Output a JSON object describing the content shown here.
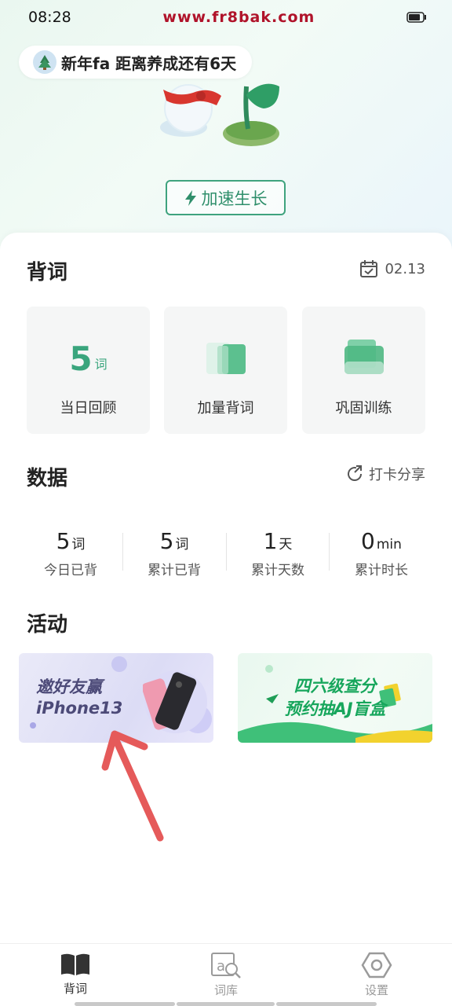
{
  "status_bar": {
    "time": "08:28",
    "watermark": "www.fr8bak.com"
  },
  "plant": {
    "message": "新年fa 距离养成还有6天",
    "accelerate_label": "加速生长"
  },
  "study": {
    "title": "背词",
    "date": "02.13",
    "tiles": [
      {
        "value": "5",
        "unit": "词",
        "label": "当日回顾"
      },
      {
        "label": "加量背词"
      },
      {
        "label": "巩固训练"
      }
    ]
  },
  "stats": {
    "title": "数据",
    "share_label": "打卡分享",
    "items": [
      {
        "value": "5",
        "unit": "词",
        "label": "今日已背"
      },
      {
        "value": "5",
        "unit": "词",
        "label": "累计已背"
      },
      {
        "value": "1",
        "unit": "天",
        "label": "累计天数"
      },
      {
        "value": "0",
        "unit": "min",
        "label": "累计时长"
      }
    ]
  },
  "activities": {
    "title": "活动",
    "banner1": {
      "line1": "邀好友赢",
      "line2": "iPhone13"
    },
    "banner2": {
      "line1": "四六级查分",
      "line2": "预约抽AJ盲盒"
    }
  },
  "tabs": [
    {
      "label": "背词",
      "active": true
    },
    {
      "label": "词库",
      "active": false
    },
    {
      "label": "设置",
      "active": false
    }
  ],
  "colors": {
    "accent": "#3aa57d",
    "annotation_arrow": "#e55a5a"
  }
}
